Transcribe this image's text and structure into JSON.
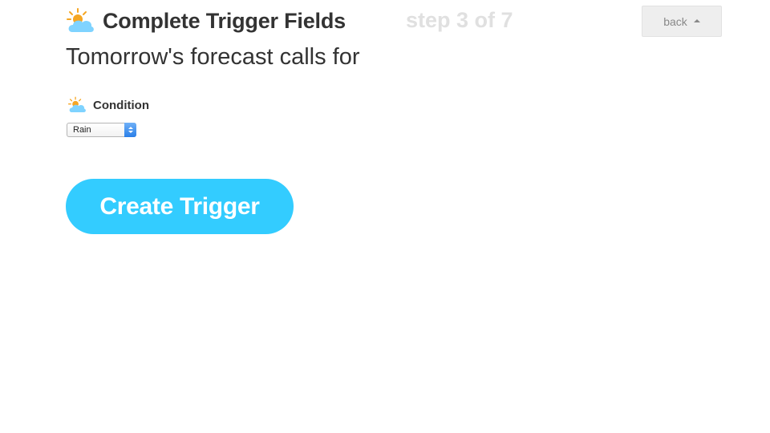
{
  "header": {
    "title": "Complete Trigger Fields",
    "step": "step 3 of 7",
    "icon": "weather-partly-cloudy-icon",
    "back_label": "back"
  },
  "trigger": {
    "subtitle": "Tomorrow's forecast calls for"
  },
  "condition_field": {
    "label": "Condition",
    "icon": "weather-partly-cloudy-icon",
    "selected_value": "Rain"
  },
  "actions": {
    "create_label": "Create Trigger"
  },
  "colors": {
    "accent": "#33ccff",
    "title": "#333333",
    "step": "#e0e0e0",
    "back_bg": "#eeeeee"
  }
}
